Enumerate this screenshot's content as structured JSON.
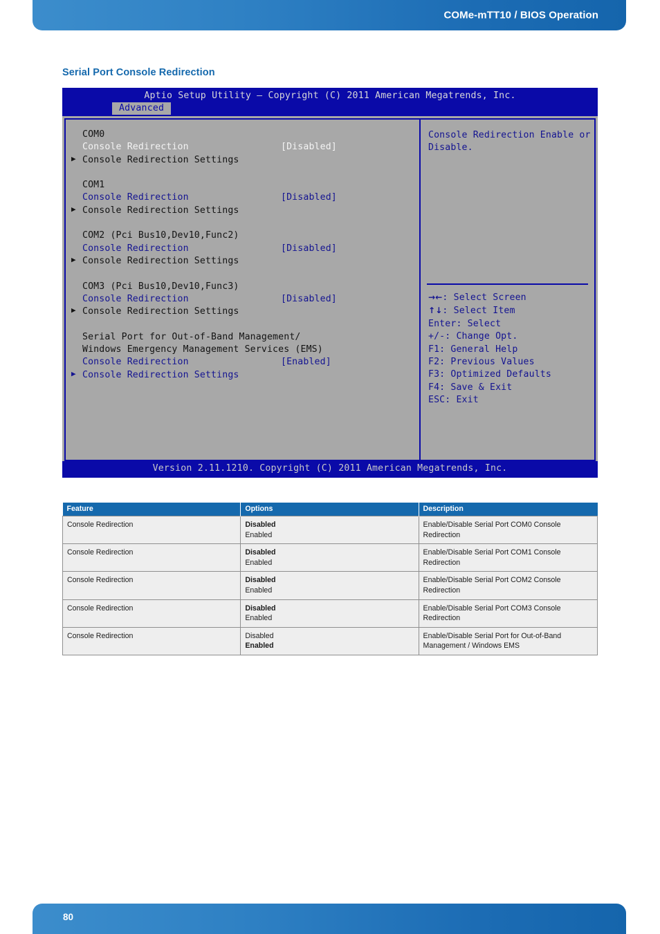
{
  "header": {
    "title": "COMe-mTT10 / BIOS Operation"
  },
  "section": {
    "title": "Serial Port Console Redirection"
  },
  "bios": {
    "titlebar": "Aptio Setup Utility – Copyright (C) 2011 American Megatrends, Inc.",
    "active_tab": "Advanced",
    "footer": "Version 2.11.1210. Copyright (C) 2011 American Megatrends, Inc.",
    "groups": [
      {
        "heading": "COM0",
        "setting_label": "Console Redirection",
        "setting_value": "[Disabled]",
        "submenu_label": "Console Redirection Settings",
        "submenu_bullet": "▶"
      },
      {
        "heading": "COM1",
        "setting_label": "Console Redirection",
        "setting_value": "[Disabled]",
        "submenu_label": "Console Redirection Settings",
        "submenu_bullet": "▶"
      },
      {
        "heading": "COM2 (Pci Bus10,Dev10,Func2)",
        "setting_label": "Console Redirection",
        "setting_value": "[Disabled]",
        "submenu_label": "Console Redirection Settings",
        "submenu_bullet": "▶"
      },
      {
        "heading": "COM3 (Pci Bus10,Dev10,Func3)",
        "setting_label": "Console Redirection",
        "setting_value": "[Disabled]",
        "submenu_label": "Console Redirection Settings",
        "submenu_bullet": "▶"
      },
      {
        "heading": "Serial Port for Out-of-Band Management/",
        "heading2": "Windows Emergency Management Services (EMS)",
        "setting_label": "Console Redirection",
        "setting_value": "[Enabled]",
        "submenu_label": "Console Redirection Settings",
        "submenu_bullet": "▶"
      }
    ],
    "help": {
      "line1": "Console Redirection Enable or",
      "line2": "Disable."
    },
    "keys": [
      {
        "glyph": "→←",
        "text": ": Select Screen"
      },
      {
        "glyph": "↑↓",
        "text": ": Select Item"
      },
      {
        "glyph": "",
        "text": "Enter: Select"
      },
      {
        "glyph": "",
        "text": "+/-: Change Opt."
      },
      {
        "glyph": "",
        "text": "F1: General Help"
      },
      {
        "glyph": "",
        "text": "F2: Previous Values"
      },
      {
        "glyph": "",
        "text": "F3: Optimized Defaults"
      },
      {
        "glyph": "",
        "text": "F4: Save & Exit"
      },
      {
        "glyph": "",
        "text": "ESC: Exit"
      }
    ]
  },
  "table": {
    "headers": [
      "Feature",
      "Options",
      "Description"
    ],
    "rows": [
      {
        "feature": "Console Redirection",
        "option1": "Disabled",
        "option1_bold": true,
        "option2": "Enabled",
        "option2_bold": false,
        "description": "Enable/Disable Serial Port COM0 Console Redirection",
        "description2": ""
      },
      {
        "feature": "Console Redirection",
        "option1": "Disabled",
        "option1_bold": true,
        "option2": "Enabled",
        "option2_bold": false,
        "description": "Enable/Disable Serial Port COM1 Console Redirection",
        "description2": ""
      },
      {
        "feature": "Console Redirection",
        "option1": "Disabled",
        "option1_bold": true,
        "option2": "Enabled",
        "option2_bold": false,
        "description": "Enable/Disable Serial Port COM2 Console Redirection",
        "description2": ""
      },
      {
        "feature": "Console Redirection",
        "option1": "Disabled",
        "option1_bold": true,
        "option2": "Enabled",
        "option2_bold": false,
        "description": "Enable/Disable Serial Port COM3 Console Redirection",
        "description2": ""
      },
      {
        "feature": "Console Redirection",
        "option1": "Disabled",
        "option1_bold": false,
        "option2": "Enabled",
        "option2_bold": true,
        "description": "Enable/Disable Serial Port for Out-of-Band",
        "description2": "Management / Windows EMS"
      }
    ]
  },
  "footer": {
    "page_number": "80"
  }
}
